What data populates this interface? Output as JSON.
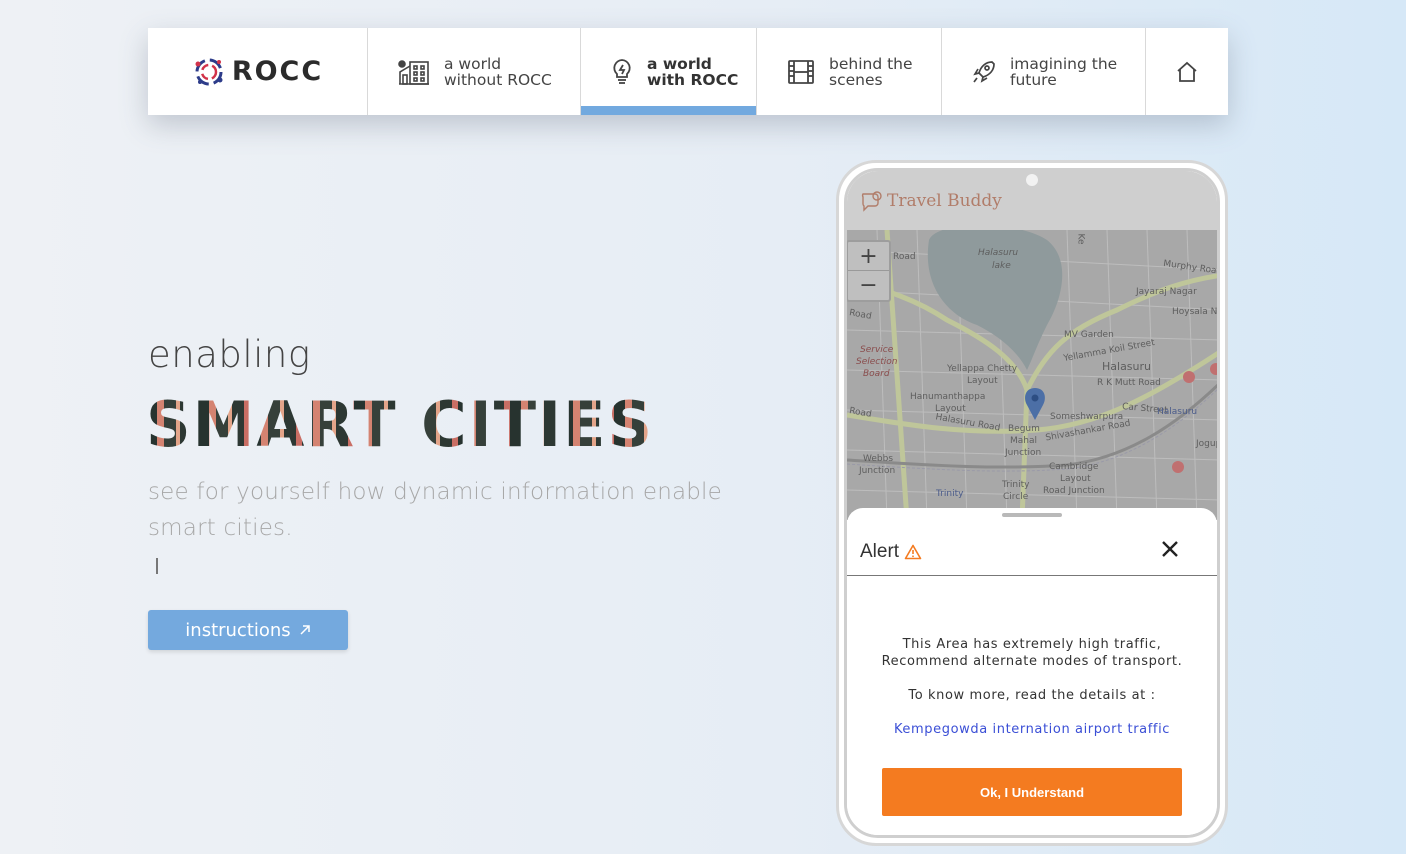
{
  "nav": {
    "logo_text": "ROCC",
    "items": [
      {
        "line1": "a world",
        "line2": "without ROCC",
        "icon": "building-icon"
      },
      {
        "line1": "a world",
        "line2": "with ROCC",
        "icon": "lightbulb-icon",
        "active": true
      },
      {
        "line1": "behind the",
        "line2": "scenes",
        "icon": "film-icon"
      },
      {
        "line1": "imagining the",
        "line2": "future",
        "icon": "rocket-icon"
      }
    ],
    "home_icon": "home-icon"
  },
  "hero": {
    "enabling": "enabling",
    "headline": "SMART CITIES",
    "subtitle": "see for yourself how dynamic information enable smart cities.",
    "button_label": "instructions"
  },
  "phone": {
    "app_title": "Travel Buddy",
    "map": {
      "zoom_in": "+",
      "zoom_out": "−",
      "labels": {
        "road1": "Road",
        "lake": "Halasuru",
        "lake2": "lake",
        "murphy": "Murphy Road",
        "jayaraj": "Jayaraj Nagar",
        "hoysala": "Hoysala Naga",
        "road2": "Road",
        "mvgarden": "MV Garden",
        "yellamma": "Yellamma Koil Street",
        "service": "Service",
        "selection": "Selection",
        "board": "Board",
        "yellappa": "Yellappa Chetty",
        "layout1": "Layout",
        "halasuru": "Halasuru",
        "rkmutt": "R K Mutt Road",
        "hanumanth": "Hanumanthappa",
        "layout2": "Layout",
        "carstreet": "Car Street",
        "halasuru2": "Halasuru",
        "road3": "Road",
        "halasururoad": "Halasuru Road",
        "someshwar": "Someshwarpura",
        "shivashankar": "Shivashankar Road",
        "begum": "Begum",
        "mahal": "Mahal",
        "junction": "Junction",
        "jogupal": "Jogupal",
        "webbs": "Webbs",
        "junction2": "Junction",
        "cambridge": "Cambridge",
        "layout3": "Layout",
        "cjunction": "Road Junction",
        "trinity": "Trinity",
        "trinity2": "Trinity",
        "circle": "Circle",
        "ke": "Ke"
      }
    },
    "alert": {
      "title": "Alert",
      "line1": "This Area has extremely high traffic, Recommend alternate modes of transport.",
      "line2": "To know more, read the details at :",
      "link": "Kempegowda internation airport traffic",
      "ok_label": "Ok, I Understand"
    }
  },
  "colors": {
    "accent": "#72a9df",
    "button": "#74a9de",
    "alert_button": "#f47b20",
    "warning": "#f47b20",
    "link": "#3b4fd6"
  }
}
